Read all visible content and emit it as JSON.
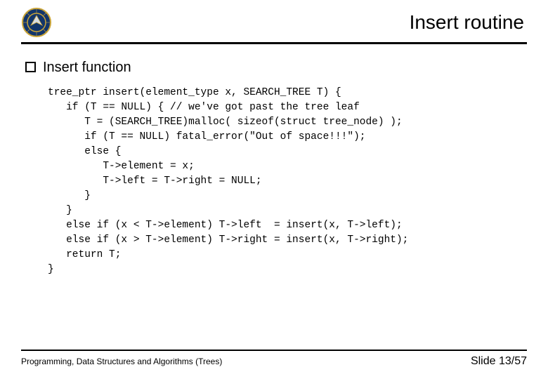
{
  "header": {
    "title": "Insert routine",
    "logo_alt": "seal-logo"
  },
  "bullet": {
    "text": "Insert function"
  },
  "code": {
    "l01": "tree_ptr insert(element_type x, SEARCH_TREE T) {",
    "l02": "   if (T == NULL) { // we've got past the tree leaf",
    "l03": "      T = (SEARCH_TREE)malloc( sizeof(struct tree_node) );",
    "l04": "      if (T == NULL) fatal_error(\"Out of space!!!\");",
    "l05": "      else {",
    "l06": "         T->element = x;",
    "l07": "         T->left = T->right = NULL;",
    "l08": "      }",
    "l09": "   }",
    "l10": "   else if (x < T->element) T->left  = insert(x, T->left);",
    "l11": "   else if (x > T->element) T->right = insert(x, T->right);",
    "l12": "   return T;",
    "l13": "}"
  },
  "footer": {
    "left": "Programming, Data Structures and Algorithms (Trees)",
    "right": "Slide 13/57"
  }
}
